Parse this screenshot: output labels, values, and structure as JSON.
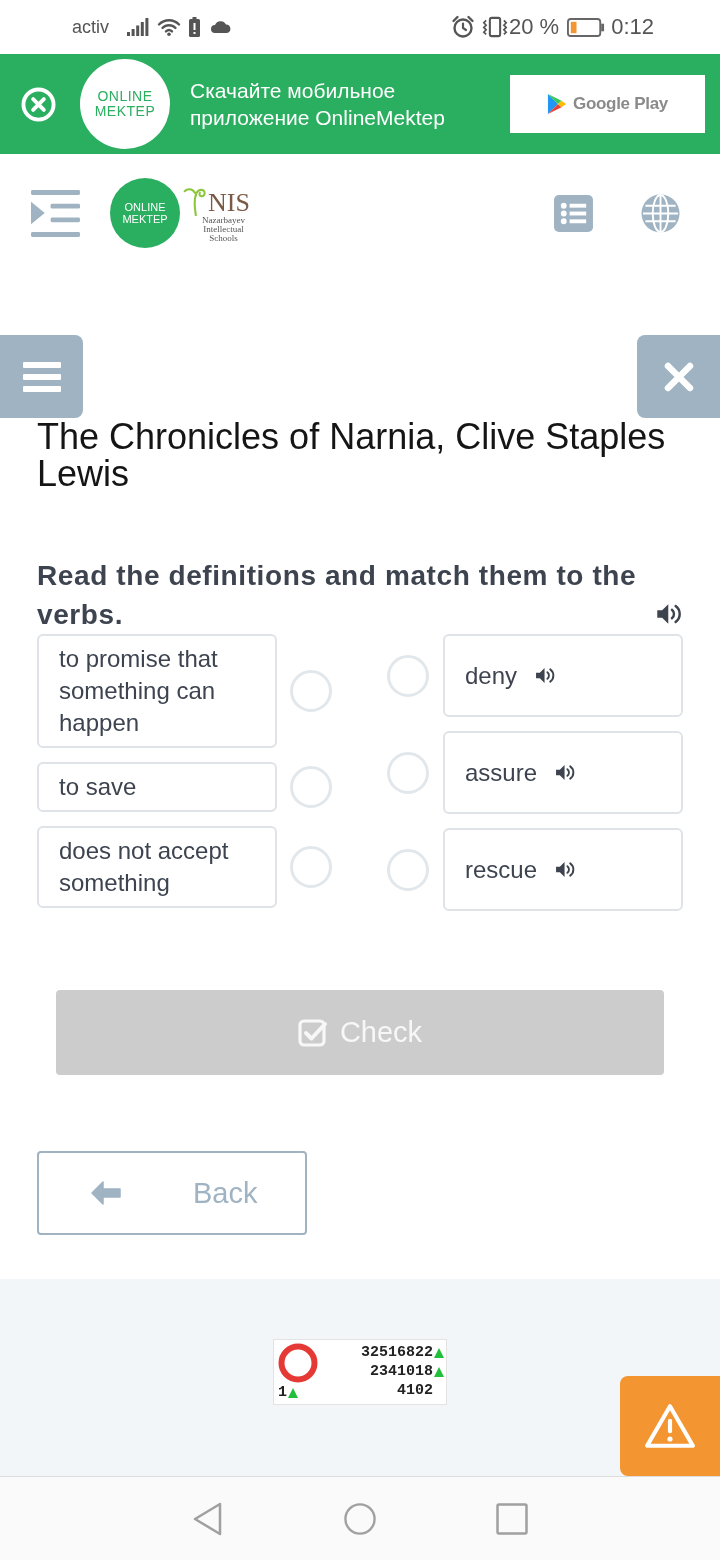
{
  "status_bar": {
    "carrier": "activ",
    "battery": "20 %",
    "time": "0:12"
  },
  "app_banner": {
    "logo": "ONLINE MEKTEP",
    "message": "Скачайте мобильное приложение OnlineMektep",
    "store_button": "Google Play"
  },
  "header": {
    "logo": "ONLINE MEKTEP",
    "partner_logo": {
      "name": "NIS",
      "subtitle": "Nazarbayev Intellectual Schools"
    }
  },
  "lesson": {
    "title": "The Chronicles of Narnia, Clive Staples Lewis",
    "instruction": "Read the definitions and match them to the verbs.",
    "definitions": [
      {
        "text": "to promise that something can happen",
        "selected": false
      },
      {
        "text": "to save",
        "selected": false
      },
      {
        "text": "does not accept something",
        "selected": false
      }
    ],
    "words": [
      {
        "text": "deny",
        "selected": false
      },
      {
        "text": "assure",
        "selected": false
      },
      {
        "text": "rescue",
        "selected": false
      }
    ],
    "check_button": {
      "label": "Check",
      "disabled": true
    },
    "back_button": {
      "label": "Back"
    }
  },
  "counter": {
    "totals": [
      {
        "value": "32516822",
        "up": true
      },
      {
        "value": "2341018",
        "up": true
      },
      {
        "value": "4102",
        "up": false
      }
    ],
    "online": {
      "value": "1",
      "up": true
    }
  }
}
